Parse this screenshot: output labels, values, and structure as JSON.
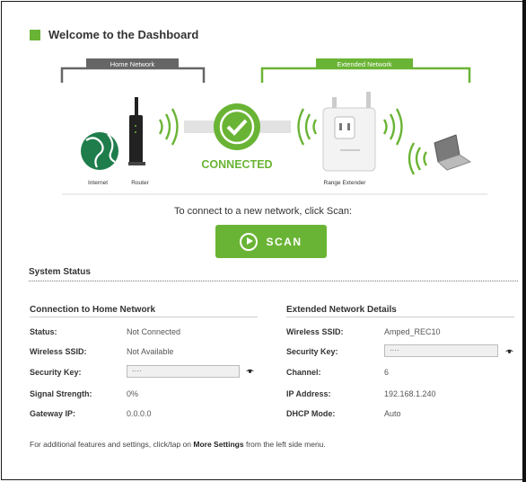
{
  "header": {
    "title": "Welcome to the Dashboard"
  },
  "diagram": {
    "home_network_label": "Home Network",
    "extended_network_label": "Extended Network",
    "internet_label": "Internet",
    "router_label": "Router",
    "connected_label": "CONNECTED",
    "range_extender_label": "Range Extender"
  },
  "scan": {
    "prompt": "To connect to a new network, click Scan:",
    "button_label": "SCAN"
  },
  "system_status": {
    "title": "System Status"
  },
  "home_network": {
    "title": "Connection to Home Network",
    "rows": [
      {
        "label": "Status:",
        "value": "Not Connected"
      },
      {
        "label": "Wireless SSID:",
        "value": "Not Available"
      },
      {
        "label": "Security Key:",
        "value": "····"
      },
      {
        "label": "Signal Strength:",
        "value": "0%"
      },
      {
        "label": "Gateway IP:",
        "value": "0.0.0.0"
      }
    ]
  },
  "extended_network": {
    "title": "Extended Network Details",
    "rows": [
      {
        "label": "Wireless SSID:",
        "value": "Amped_REC10"
      },
      {
        "label": "Security Key:",
        "value": "····"
      },
      {
        "label": "Channel:",
        "value": "6"
      },
      {
        "label": "IP Address:",
        "value": "192.168.1.240"
      },
      {
        "label": "DHCP Mode:",
        "value": "Auto"
      }
    ]
  },
  "footer": {
    "prefix": "For additional features and settings, click/tap on ",
    "bold": "More Settings",
    "suffix": " from the left side menu."
  },
  "colors": {
    "accent": "#6ab435",
    "dark_label": "#555555"
  },
  "icons": {
    "scan_button": "play-circle-icon",
    "show_key": "eye-icon",
    "status": "checkmark-icon"
  }
}
